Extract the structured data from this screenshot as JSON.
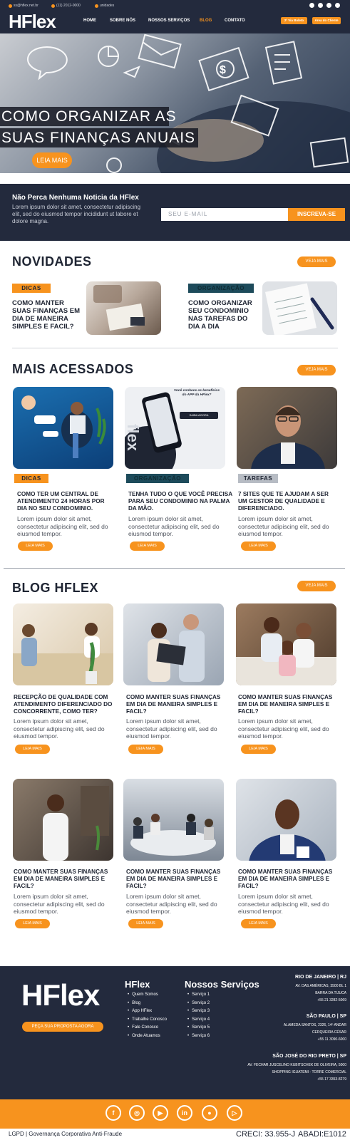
{
  "topbar": {
    "email": "ss@hflex.net.br",
    "phone": "(11) 2012-0000",
    "location": "unidades",
    "logo": "HFlex",
    "nav": [
      "HOME",
      "SOBRE NÓS",
      "NOSSOS SERVIÇOS",
      "BLOG",
      "CONTATO"
    ],
    "active_nav": "BLOG",
    "button1": "2ª Via Boleto",
    "button2": "Área do Cliente"
  },
  "hero": {
    "line1": "COMO ORGANIZAR AS",
    "line2": "SUAS FINANÇAS ANUAIS",
    "button": "LEIA MAIS"
  },
  "newsletter": {
    "title": "Não Perca Nenhuma Noticia da HFlex",
    "text": "Lorem ipsum dolor sit amet, consectetur adipiscing elit, sed do eiusmod tempor incididunt ut labore et dolore magna.",
    "placeholder": "SEU E-MAIL",
    "button": "INSCREVA-SE"
  },
  "novidades": {
    "title": "NOVIDADES",
    "veja_mais": "VEJA MAIS",
    "items": [
      {
        "tag": "DICAS",
        "title": "COMO MANTER SUAS FINANÇAS EM DIA DE MANEIRA SIMPLES E FACIL?"
      },
      {
        "tag": "ORGANIZAÇÃO",
        "title": "COMO ORGANIZAR SEU CONDOMINIO NAS TAREFAS DO DIA A DIA"
      }
    ]
  },
  "mais_acessados": {
    "title": "MAIS ACESSADOS",
    "veja_mais": "VEJA MAIS",
    "app_promo": {
      "line1": "Você conhece os benefícios",
      "line2": "do APP da HFlex?",
      "button": "SAIBA AGORA"
    },
    "items": [
      {
        "tag": "DICAS",
        "title": "COMO TER UM CENTRAL DE ATENDIMENTO 24 HORAS POR DIA NO SEU CONDOMINIO.",
        "text": "Lorem ipsum dolor sit amet, consectetur adipiscing elit, sed do eiusmod tempor.",
        "button": "LEIA MAIS"
      },
      {
        "tag": "ORGANIZAÇÃO",
        "title": "TENHA TUDO O QUE VOCÊ PRECISA PARA SEU CONDOMINIO NA PALMA DA MÃO.",
        "text": "Lorem ipsum dolor sit amet, consectetur adipiscing elit, sed do eiusmod tempor.",
        "button": "LEIA MAIS"
      },
      {
        "tag": "TAREFAS",
        "title": "7 SITES QUE TE AJUDAM A SER UM GESTOR DE QUALIDADE E DIFERENCIADO.",
        "text": "Lorem ipsum dolor sit amet, consectetur adipiscing elit, sed do eiusmod tempor.",
        "button": "LEIA MAIS"
      }
    ]
  },
  "blog": {
    "title": "BLOG HFLEX",
    "veja_mais": "VEJA MAIS",
    "items": [
      {
        "title": "RECEPÇÃO DE QUALIDADE COM ATENDIMENTO DIFERENCIADO DO CONCORRENTE, COMO TER?",
        "text": "Lorem ipsum dolor sit amet, consectetur adipiscing elit, sed do eiusmod tempor.",
        "button": "LEIA MAIS"
      },
      {
        "title": "COMO MANTER SUAS FINANÇAS EM DIA DE MANEIRA SIMPLES E FACIL?",
        "text": "Lorem ipsum dolor sit amet, consectetur adipiscing elit, sed do eiusmod tempor.",
        "button": "LEIA MAIS"
      },
      {
        "title": "COMO MANTER SUAS FINANÇAS EM DIA DE MANEIRA SIMPLES E FACIL?",
        "text": "Lorem ipsum dolor sit amet, consectetur adipiscing elit, sed do eiusmod tempor.",
        "button": "LEIA MAIS"
      },
      {
        "title": "COMO MANTER SUAS FINANÇAS EM DIA DE MANEIRA SIMPLES E FACIL?",
        "text": "Lorem ipsum dolor sit amet, consectetur adipiscing elit, sed do eiusmod tempor.",
        "button": "LEIA MAIS"
      },
      {
        "title": "COMO MANTER SUAS FINANÇAS EM DIA DE MANEIRA SIMPLES E FACIL?",
        "text": "Lorem ipsum dolor sit amet, consectetur adipiscing elit, sed do eiusmod tempor.",
        "button": "LEIA MAIS"
      },
      {
        "title": "COMO MANTER SUAS FINANÇAS EM DIA DE MANEIRA SIMPLES E FACIL?",
        "text": "Lorem ipsum dolor sit amet, consectetur adipiscing elit, sed do eiusmod tempor.",
        "button": "LEIA MAIS"
      }
    ]
  },
  "footer": {
    "logo": "HFlex",
    "cta": "PEÇA SUA PROPOSTA AGORA",
    "hflex_title": "HFlex",
    "hflex_links": [
      "Quem Somos",
      "Blog",
      "App HFlex",
      "Trabalhe Conosco",
      "Fale Conosco",
      "Onde Atuamos"
    ],
    "services_title": "Nossos Serviços",
    "services": [
      "Serviço 1",
      "Serviço 2",
      "Serviço 3",
      "Serviço 4",
      "Serviço 5",
      "Serviço 6"
    ],
    "offices": [
      {
        "city": "RIO DE JANEIRO | RJ",
        "lines": [
          "AV. DAS AMÉRICAS, 3500 BL 1",
          "BARRA DA TIJUCA",
          "+55 21 3282-5069"
        ]
      },
      {
        "city": "SÃO PAULO | SP",
        "lines": [
          "ALAMEDA SANTOS, 2326, 14º ANDAR",
          "CERQUEIRA CÉSAR",
          "+55 11 3090-6000"
        ]
      },
      {
        "city": "SÃO JOSÉ DO RIO PRETO | SP",
        "lines": [
          "AV. FECHAR JUSCELINO KUBITSCHEK DE OLIVEIRA, 5000",
          "SHOPPING IGUATEMI - TORRE COMERCIAL",
          "+55 17 3353-8279"
        ]
      }
    ],
    "social": [
      "facebook-icon",
      "instagram-icon",
      "youtube-icon",
      "linkedin-icon",
      "apple-icon",
      "play-store-icon"
    ],
    "bottom_left": "LGPD | Governança Corporativa Anti-Fraude",
    "creci": "CRECI: 33.955-J",
    "abadi": "ABADI:E1012"
  },
  "colors": {
    "navy": "#232a3d",
    "orange": "#f7931e",
    "teal": "#1d4b5b"
  }
}
